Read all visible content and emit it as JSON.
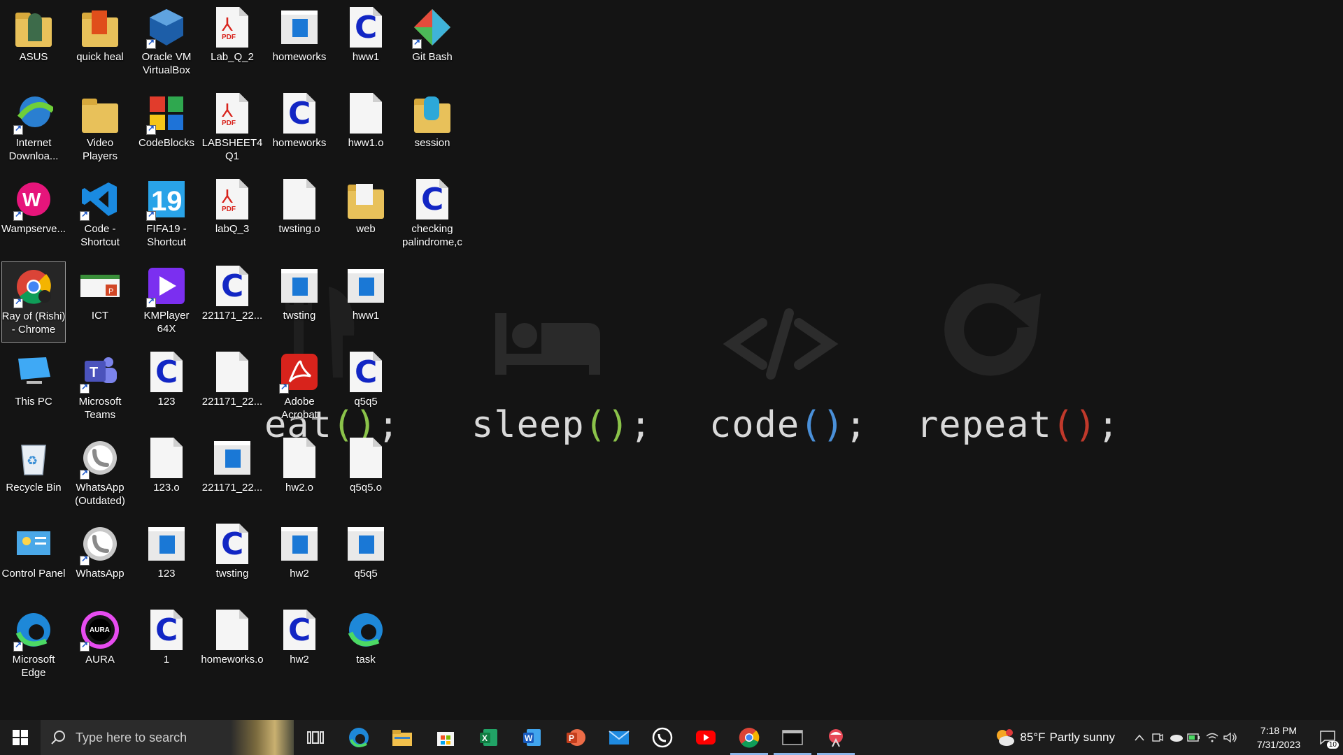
{
  "wallpaper": {
    "words": [
      {
        "name": "eat",
        "color_parens": "#8bc34a"
      },
      {
        "name": "sleep",
        "color_parens": "#8bc34a"
      },
      {
        "name": "code",
        "color_parens": "#4a90d9"
      },
      {
        "name": "repeat",
        "color_parens": "#c0392b"
      }
    ],
    "text": {
      "eat": "eat",
      "sleep": "sleep",
      "code": "code",
      "repeat": "repeat",
      "open": "(",
      "close": ")",
      "semi": ";"
    }
  },
  "desktop": {
    "icons": [
      {
        "label": "ASUS",
        "kind": "folder-user",
        "selected": false
      },
      {
        "label": "Internet Downloa...",
        "kind": "idm",
        "shortcut": true
      },
      {
        "label": "Wampserve...",
        "kind": "wamp",
        "shortcut": true
      },
      {
        "label": "Ray of (Rishi) - Chrome",
        "kind": "chrome",
        "shortcut": true,
        "selected": true
      },
      {
        "label": "This PC",
        "kind": "pc"
      },
      {
        "label": "Recycle Bin",
        "kind": "bin"
      },
      {
        "label": "Control Panel",
        "kind": "cpanel"
      },
      {
        "label": "Microsoft Edge",
        "kind": "edge",
        "shortcut": true
      },
      {
        "label": "quick heal",
        "kind": "folder-qh"
      },
      {
        "label": "Video Players",
        "kind": "folder"
      },
      {
        "label": "Code - Shortcut",
        "kind": "vscode",
        "shortcut": true
      },
      {
        "label": "ICT",
        "kind": "ict"
      },
      {
        "label": "Microsoft Teams",
        "kind": "teams",
        "shortcut": true
      },
      {
        "label": "WhatsApp (Outdated)",
        "kind": "whatsapp",
        "shortcut": true
      },
      {
        "label": "WhatsApp",
        "kind": "whatsapp",
        "shortcut": true
      },
      {
        "label": "AURA",
        "kind": "aura",
        "shortcut": true
      },
      {
        "label": "Oracle VM VirtualBox",
        "kind": "vbox",
        "shortcut": true
      },
      {
        "label": "CodeBlocks",
        "kind": "codeblocks",
        "shortcut": true
      },
      {
        "label": "FIFA19 - Shortcut",
        "kind": "fifa",
        "shortcut": true
      },
      {
        "label": "KMPlayer 64X",
        "kind": "kmplayer",
        "shortcut": true
      },
      {
        "label": "123",
        "kind": "cdoc"
      },
      {
        "label": "123.o",
        "kind": "doc"
      },
      {
        "label": "123",
        "kind": "win"
      },
      {
        "label": "1",
        "kind": "cdoc"
      },
      {
        "label": "Lab_Q_2",
        "kind": "pdf"
      },
      {
        "label": "LABSHEET4 Q1",
        "kind": "pdf"
      },
      {
        "label": "labQ_3",
        "kind": "pdf"
      },
      {
        "label": "221171_22...",
        "kind": "cdoc"
      },
      {
        "label": "221171_22...",
        "kind": "doc"
      },
      {
        "label": "221171_22...",
        "kind": "win"
      },
      {
        "label": "twsting",
        "kind": "cdoc"
      },
      {
        "label": "homeworks.o",
        "kind": "doc"
      },
      {
        "label": "homeworks",
        "kind": "win"
      },
      {
        "label": "homeworks",
        "kind": "cdoc"
      },
      {
        "label": "twsting.o",
        "kind": "doc"
      },
      {
        "label": "twsting",
        "kind": "win"
      },
      {
        "label": "Adobe Acrobat",
        "kind": "acrobat",
        "shortcut": true
      },
      {
        "label": "hw2.o",
        "kind": "doc"
      },
      {
        "label": "hw2",
        "kind": "win"
      },
      {
        "label": "hw2",
        "kind": "cdoc"
      },
      {
        "label": "hww1",
        "kind": "cdoc"
      },
      {
        "label": "hww1.o",
        "kind": "doc"
      },
      {
        "label": "web",
        "kind": "folder-web"
      },
      {
        "label": "hww1",
        "kind": "win"
      },
      {
        "label": "q5q5",
        "kind": "cdoc"
      },
      {
        "label": "q5q5.o",
        "kind": "doc"
      },
      {
        "label": "q5q5",
        "kind": "win"
      },
      {
        "label": "task",
        "kind": "edge"
      },
      {
        "label": "Git Bash",
        "kind": "git",
        "shortcut": true
      },
      {
        "label": "session",
        "kind": "folder-session"
      },
      {
        "label": "checking palindrome,c",
        "kind": "cdoc"
      }
    ]
  },
  "taskbar": {
    "search_placeholder": "Type here to search",
    "apps": [
      {
        "name": "task-view"
      },
      {
        "name": "edge"
      },
      {
        "name": "file-explorer"
      },
      {
        "name": "store"
      },
      {
        "name": "excel"
      },
      {
        "name": "word"
      },
      {
        "name": "powerpoint"
      },
      {
        "name": "mail"
      },
      {
        "name": "whatsapp"
      },
      {
        "name": "youtube"
      },
      {
        "name": "chrome",
        "active": true
      },
      {
        "name": "terminal",
        "active": true
      },
      {
        "name": "snipping",
        "active": true
      }
    ],
    "weather": {
      "temp": "85°F",
      "desc": "Partly sunny"
    },
    "clock": {
      "time": "7:18 PM",
      "date": "7/31/2023"
    },
    "notifications": "10"
  },
  "colors": {
    "accent": "#8ab4e8",
    "c_blue": "#1226c4",
    "pdf_red": "#d8231c"
  }
}
